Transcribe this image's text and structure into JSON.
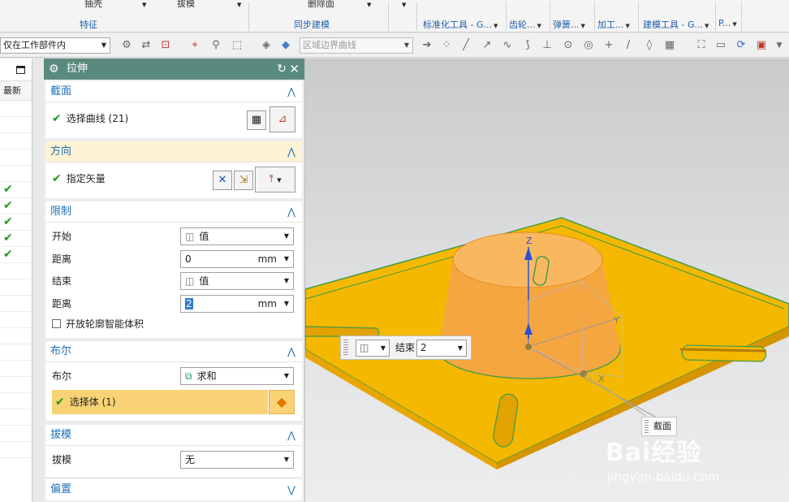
{
  "ribbon": {
    "fragments": [
      "抽壳",
      "拔模",
      "删除面"
    ],
    "groups": [
      "特征",
      "同步建模",
      "标准化工具 - G...",
      "齿轮...",
      "弹簧...",
      "加工...",
      "建模工具 - G...",
      "P..."
    ]
  },
  "selection_bar": {
    "filter_value": "仅在工作部件内",
    "scope_placeholder": "区域边界曲线"
  },
  "left_strip": {
    "column_header": "最新",
    "checked_rows": 5
  },
  "dialog": {
    "title": "拉伸",
    "sections": {
      "section": {
        "header": "截面",
        "row_label": "选择曲线 (21)"
      },
      "direction": {
        "header": "方向",
        "row_label": "指定矢量"
      },
      "limits": {
        "header": "限制",
        "start_label": "开始",
        "start_value": "值",
        "distance1_label": "距离",
        "distance1_value": "0",
        "distance1_unit": "mm",
        "end_label": "结束",
        "end_value": "值",
        "distance2_label": "距离",
        "distance2_value": "2",
        "distance2_unit": "mm",
        "open_profile_label": "开放轮廓智能体积"
      },
      "boolean": {
        "header": "布尔",
        "boolean_label": "布尔",
        "boolean_value": "求和",
        "select_body_label": "选择体 (1)"
      },
      "draft": {
        "header": "拔模",
        "draft_label": "拔模",
        "draft_value": "无"
      },
      "offset": {
        "header": "偏置"
      }
    }
  },
  "viewport": {
    "float_toolbar": {
      "label": "结束",
      "value": "2"
    },
    "tooltip": "截面",
    "axis_labels": {
      "z": "Z",
      "y": "Y",
      "x": "X"
    },
    "watermark_main": "Bai经验",
    "watermark_url": "jingyan.baidu.com",
    "colors": {
      "plate": "#f5b800",
      "boss": "#f6a640",
      "edge": "#3f9a4a"
    }
  }
}
